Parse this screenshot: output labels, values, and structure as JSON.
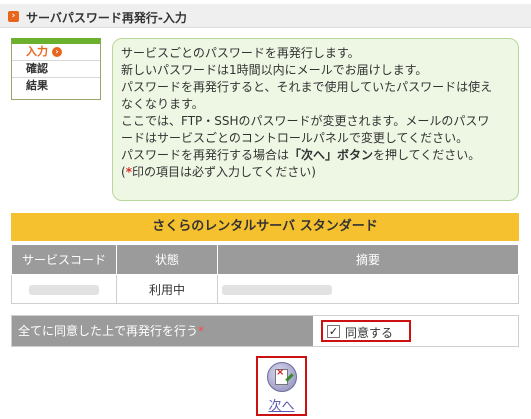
{
  "header": {
    "title": "サーバパスワード再発行-入力",
    "icon": "arrow-icon"
  },
  "steps": [
    {
      "label": "入力",
      "current": true
    },
    {
      "label": "確認",
      "current": false
    },
    {
      "label": "結果",
      "current": false
    }
  ],
  "info": {
    "line1": "サービスごとのパスワードを再発行します。",
    "line2": "新しいパスワードは1時間以内にメールでお届けします。",
    "line3": "パスワードを再発行すると、それまで使用していたパスワードは使え",
    "line4": "なくなります。",
    "line5": "ここでは、FTP・SSHのパスワードが変更されます。メールのパスワ",
    "line6": "ードはサービスごとのコントロールパネルで変更してください。",
    "line7_a": "パスワードを再発行する場合は",
    "line7_b": "「次へ」ボタン",
    "line7_c": "を押してください。",
    "line8_a": "(",
    "line8_req": "*",
    "line8_b": "印の項目は必ず入力してください)"
  },
  "plan": {
    "title": "さくらのレンタルサーバ スタンダード",
    "columns": [
      "サービスコード",
      "状態",
      "摘要"
    ],
    "rows": [
      {
        "status": "利用中"
      }
    ]
  },
  "agree": {
    "label": "全てに同意した上で再発行を行う",
    "required_mark": "*",
    "checkbox_label": "同意する",
    "checked": true
  },
  "next_button": {
    "label": "次へ"
  },
  "colors": {
    "accent_orange": "#e8651c",
    "header_yellow": "#f6c12e",
    "info_green": "#eef7e4",
    "highlight_red": "#cc1111"
  }
}
